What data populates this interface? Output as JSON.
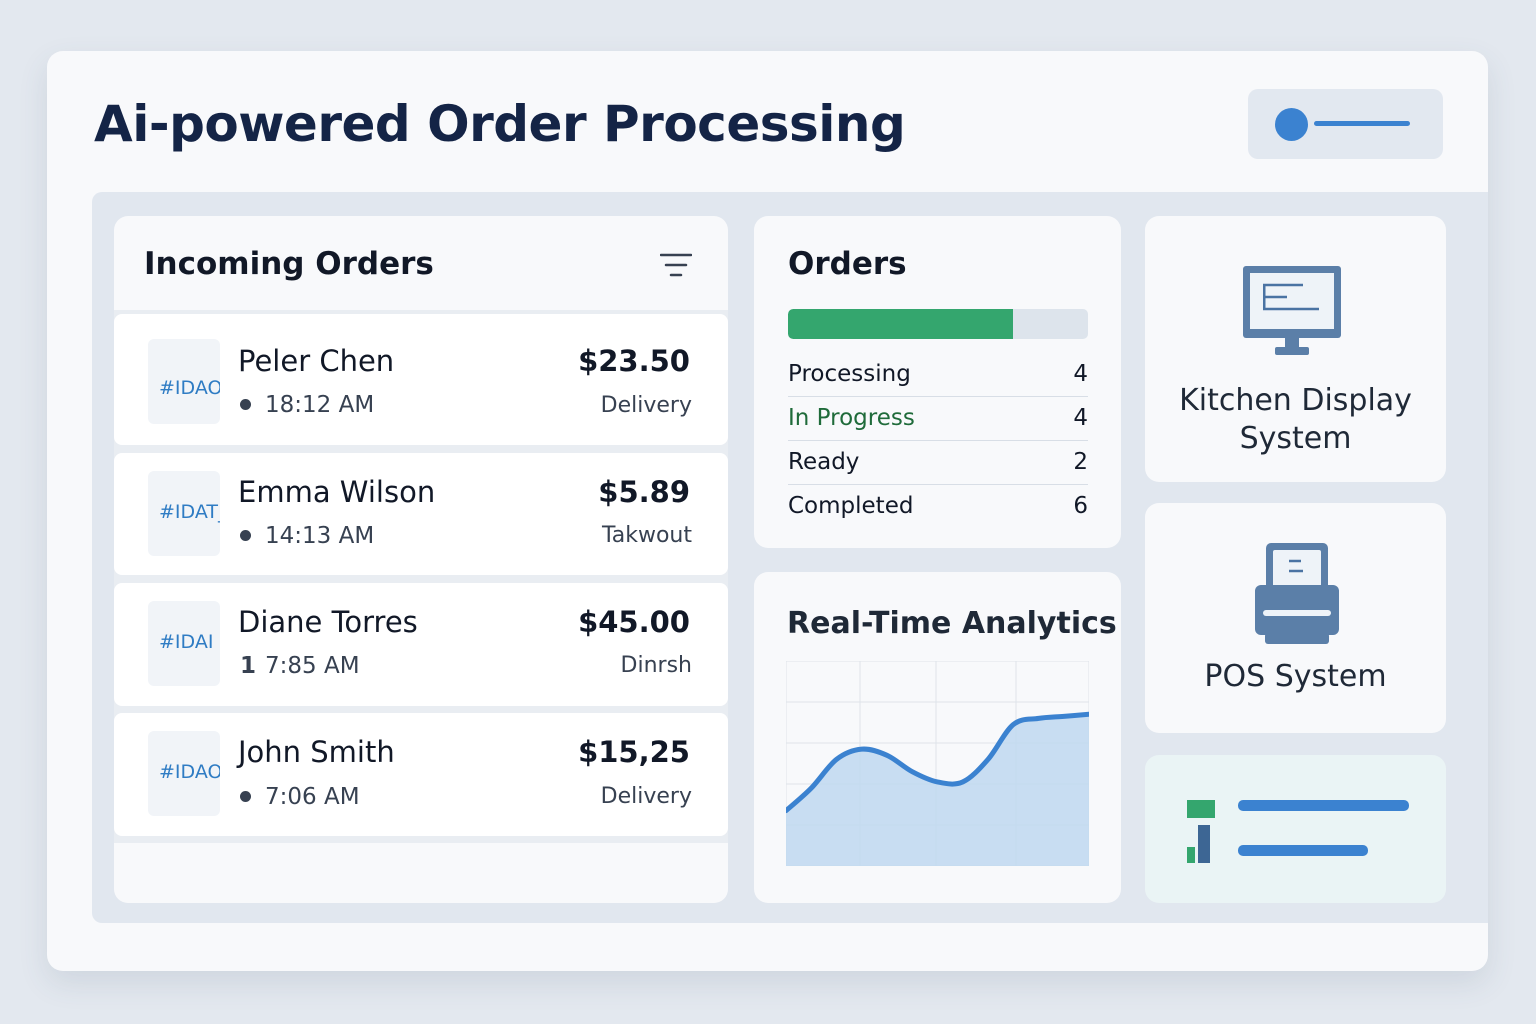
{
  "app": {
    "title": "Ai-powered Order Processing"
  },
  "incoming_orders": {
    "title": "Incoming Orders",
    "orders": [
      {
        "id": "#IDAO.",
        "name": "Peler Chen",
        "time": "18:12 AM",
        "amount": "$23.50",
        "type": "Delivery"
      },
      {
        "id": "#IDAT_",
        "name": "Emma Wilson",
        "time": "14:13 AM",
        "amount": "$5.89",
        "type": "Takwout"
      },
      {
        "id": "#IDAI",
        "name": "Diane Torres",
        "time": "7:85 AM",
        "time_marker": "1",
        "amount": "$45.00",
        "type": "Dinrsh"
      },
      {
        "id": "#IDAO",
        "name": "John Smith",
        "time": "7:06 AM",
        "amount": "$15,25",
        "type": "Delivery"
      }
    ]
  },
  "orders_status": {
    "title": "Orders",
    "progress_fraction": 0.75,
    "rows": [
      {
        "label": "Processing",
        "value": "4",
        "color": "#111827"
      },
      {
        "label": "In Progress",
        "value": "4",
        "color": "#1f6b3a"
      },
      {
        "label": "Ready",
        "value": "2",
        "color": "#111827"
      },
      {
        "label": "Completed",
        "value": "6",
        "color": "#111827"
      }
    ]
  },
  "analytics": {
    "title": "Real-Time Analytics"
  },
  "chart_data": {
    "type": "area",
    "title": "Real-Time Analytics",
    "xlabel": "",
    "ylabel": "",
    "grid": true,
    "x": [
      0,
      1,
      2,
      3,
      4,
      5,
      6,
      7,
      8,
      9,
      10,
      11,
      12
    ],
    "values": [
      0.27,
      0.38,
      0.52,
      0.57,
      0.54,
      0.46,
      0.41,
      0.41,
      0.52,
      0.69,
      0.72,
      0.73,
      0.74
    ],
    "ylim": [
      0,
      1
    ],
    "line_color": "#3b82d0",
    "fill_color": "#bfd8f0"
  },
  "kds": {
    "label": "Kitchen Display System",
    "icon": "monitor-icon"
  },
  "pos": {
    "label": "POS System",
    "icon": "printer-icon"
  },
  "colors": {
    "accent": "#3b82d0",
    "success": "#34a66e",
    "title": "#142446"
  }
}
